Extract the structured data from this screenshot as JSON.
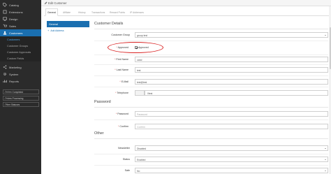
{
  "sidebar": {
    "items": [
      {
        "label": "Catalog",
        "icon": "tag-icon"
      },
      {
        "label": "Extensions",
        "icon": "puzzle-icon"
      },
      {
        "label": "Design",
        "icon": "monitor-icon"
      },
      {
        "label": "Sales",
        "icon": "cart-icon"
      },
      {
        "label": "Customers",
        "icon": "user-icon"
      },
      {
        "label": "Marketing",
        "icon": "share-icon"
      },
      {
        "label": "System",
        "icon": "gear-icon"
      },
      {
        "label": "Reports",
        "icon": "chart-icon"
      }
    ],
    "sub_items": [
      "Customers",
      "Customer Groups",
      "Customer Approvals",
      "Custom Fields"
    ],
    "stats": [
      {
        "label": "Orders Completed",
        "progress": 0.25
      },
      {
        "label": "Orders Processing",
        "progress": 0.1
      },
      {
        "label": "Other Statuses",
        "progress": 0.08
      }
    ]
  },
  "header": {
    "title": "Edit Customer"
  },
  "tabs": [
    "General",
    "Affiliate",
    "History",
    "Transactions",
    "Reward Points",
    "IP Addresses"
  ],
  "mini_nav": {
    "active": "General",
    "add": "Add Address"
  },
  "form": {
    "customer_details_title": "Customer Details",
    "customer_group_label": "Customer Group",
    "customer_group_value": "group test",
    "approved_label": "Approved",
    "approved_option": "Approved",
    "firstname_label": "First Name",
    "firstname_value": "cand",
    "lastname_label": "Last Name",
    "lastname_value": "test",
    "email_label": "E-Mail",
    "email_value": "test@test",
    "telephone_label": "Telephone",
    "telephone_value": "0test",
    "password_title": "Password",
    "password_label": "Password",
    "password_placeholder": "Password",
    "confirm_label": "Confirm",
    "confirm_placeholder": "Confirm",
    "other_title": "Other",
    "newsletter_label": "Newsletter",
    "newsletter_value": "Disabled",
    "status_label": "Status",
    "status_value": "Enabled",
    "safe_label": "Safe",
    "safe_value": "No"
  },
  "colors": {
    "sidebar": "#2b2b2b",
    "accent": "#1a6fb0",
    "annotation": "#d81f1f",
    "required": "#d9534f"
  }
}
